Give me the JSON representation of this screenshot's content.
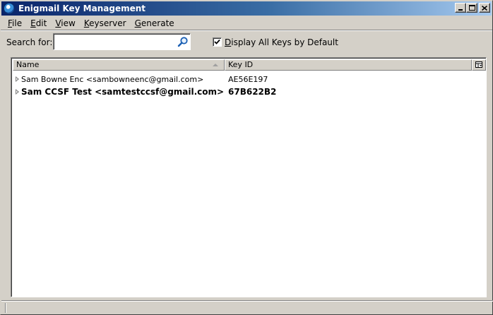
{
  "window": {
    "title": "Enigmail Key Management",
    "app_icon": "enigmail-globe-icon",
    "title_bar_gradient": [
      "#0a246a",
      "#a6caf0"
    ]
  },
  "menu": {
    "items": [
      {
        "label": "File",
        "mnemonic": "F"
      },
      {
        "label": "Edit",
        "mnemonic": "E"
      },
      {
        "label": "View",
        "mnemonic": "V"
      },
      {
        "label": "Keyserver",
        "mnemonic": "K"
      },
      {
        "label": "Generate",
        "mnemonic": "G"
      }
    ]
  },
  "search": {
    "label": "Search for:",
    "value": "",
    "icon": "magnifier-icon"
  },
  "display_all": {
    "label": "Display All Keys by Default",
    "checked": true
  },
  "table": {
    "columns": [
      {
        "label": "Name"
      },
      {
        "label": "Key ID"
      }
    ],
    "column_picker_icon": "column-picker-icon",
    "rows": [
      {
        "name": "Sam Bowne Enc <sambowneenc@gmail.com>",
        "key_id": "AE56E197",
        "bold": false
      },
      {
        "name": "Sam CCSF Test <samtestccsf@gmail.com>",
        "key_id": "67B622B2",
        "bold": true
      }
    ]
  },
  "colors": {
    "chrome": "#d4d0c8",
    "accent_icon": "#1a5fb4"
  }
}
